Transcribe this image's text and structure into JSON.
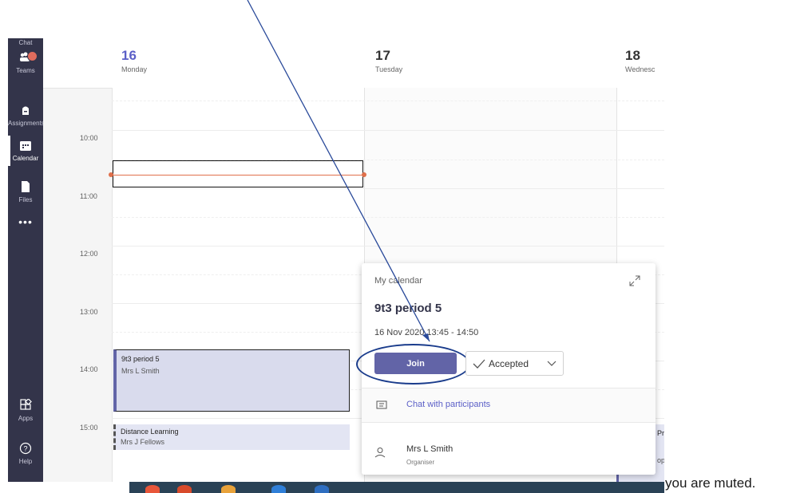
{
  "sidebar": {
    "items": [
      {
        "label": "Chat",
        "icon": "chat-icon"
      },
      {
        "label": "Teams",
        "icon": "teams-icon"
      },
      {
        "label": "Assignments",
        "icon": "assignments-icon"
      },
      {
        "label": "Calendar",
        "icon": "calendar-icon",
        "active": true
      },
      {
        "label": "Files",
        "icon": "files-icon"
      },
      {
        "label": "•••",
        "icon": "more-icon"
      },
      {
        "label": "Apps",
        "icon": "apps-icon"
      },
      {
        "label": "Help",
        "icon": "help-icon"
      }
    ]
  },
  "calendar": {
    "days": [
      {
        "number": "16",
        "name": "Monday",
        "today": true
      },
      {
        "number": "17",
        "name": "Tuesday"
      },
      {
        "number": "18",
        "name": "Wednesc"
      }
    ],
    "times": [
      "10:00",
      "11:00",
      "12:00",
      "13:00",
      "14:00",
      "15:00"
    ],
    "events": [
      {
        "title": "9t3 period 5",
        "subtitle": "Mrs L Smith"
      },
      {
        "title": "Distance Learning",
        "subtitle": "Mrs J Fellows"
      }
    ],
    "right_event": {
      "title": "Pr",
      "subtitle": "op"
    }
  },
  "popup": {
    "calendar_label": "My calendar",
    "title": "9t3 period 5",
    "time_range": "16 Nov 2020 13:45 - 14:50",
    "join_label": "Join",
    "accepted_label": "Accepted",
    "chat_label": "Chat with participants",
    "organiser_name": "Mrs L Smith",
    "organiser_role": "Organiser"
  },
  "caption": "you are muted.",
  "colors": {
    "sidebar": "#33344a",
    "accent": "#6264a7",
    "current_time": "#e0704b",
    "annotation": "#1a3c8c"
  }
}
